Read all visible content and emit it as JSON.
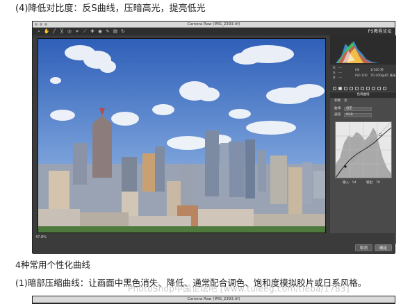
{
  "headings": {
    "step4": "(4)降低对比度：反S曲线，压暗高光，提亮低光",
    "section": "4种常用个性化曲线",
    "item1": "(1)暗部压缩曲线：让画面中黑色消失、降低、通常配合调色、饱和度模拟胶片或日系风格。"
  },
  "window": {
    "title": "Camera Raw (IMG_2393.tif)",
    "tools": [
      "zoom-icon",
      "hand-icon",
      "eyedropper-icon",
      "color-sampler-icon",
      "target-icon",
      "crop-icon",
      "straighten-icon",
      "spot-icon",
      "redeye-icon",
      "brush-icon",
      "filter-icon",
      "rotate-icon"
    ],
    "logo": "PS教程论坛",
    "readout": {
      "r_label": "R:",
      "g_label": "G:",
      "b_label": "B:",
      "aperture": "f/8",
      "shutter": "1/160 秒",
      "iso": "ISO 100",
      "lens": "70-200@85 毫米",
      "r_val": "---",
      "g_val": "---",
      "b_val": "---"
    },
    "panel": {
      "title": "色调曲线",
      "tab_label": "参数",
      "tab_label2": "点",
      "curve_label": "曲线:",
      "curve_value": "自定",
      "channel_label": "通道:",
      "channel_value": "RGB",
      "input_label": "输入:",
      "input_value": "54",
      "output_label": "输出:",
      "output_value": "70"
    },
    "zoom": "47.8%",
    "cancel_label": "取消",
    "ok_label": "确定"
  },
  "window2": {
    "title": "Camera Raw (IMG_2393.tif)"
  },
  "watermark": "PhotoShop中国论坛吧 [www.tuieeg.com/tieba/1783]",
  "colors": {
    "sky": "#4a78c8",
    "panel": "#4a4a4a",
    "window": "#3b3b3b"
  }
}
